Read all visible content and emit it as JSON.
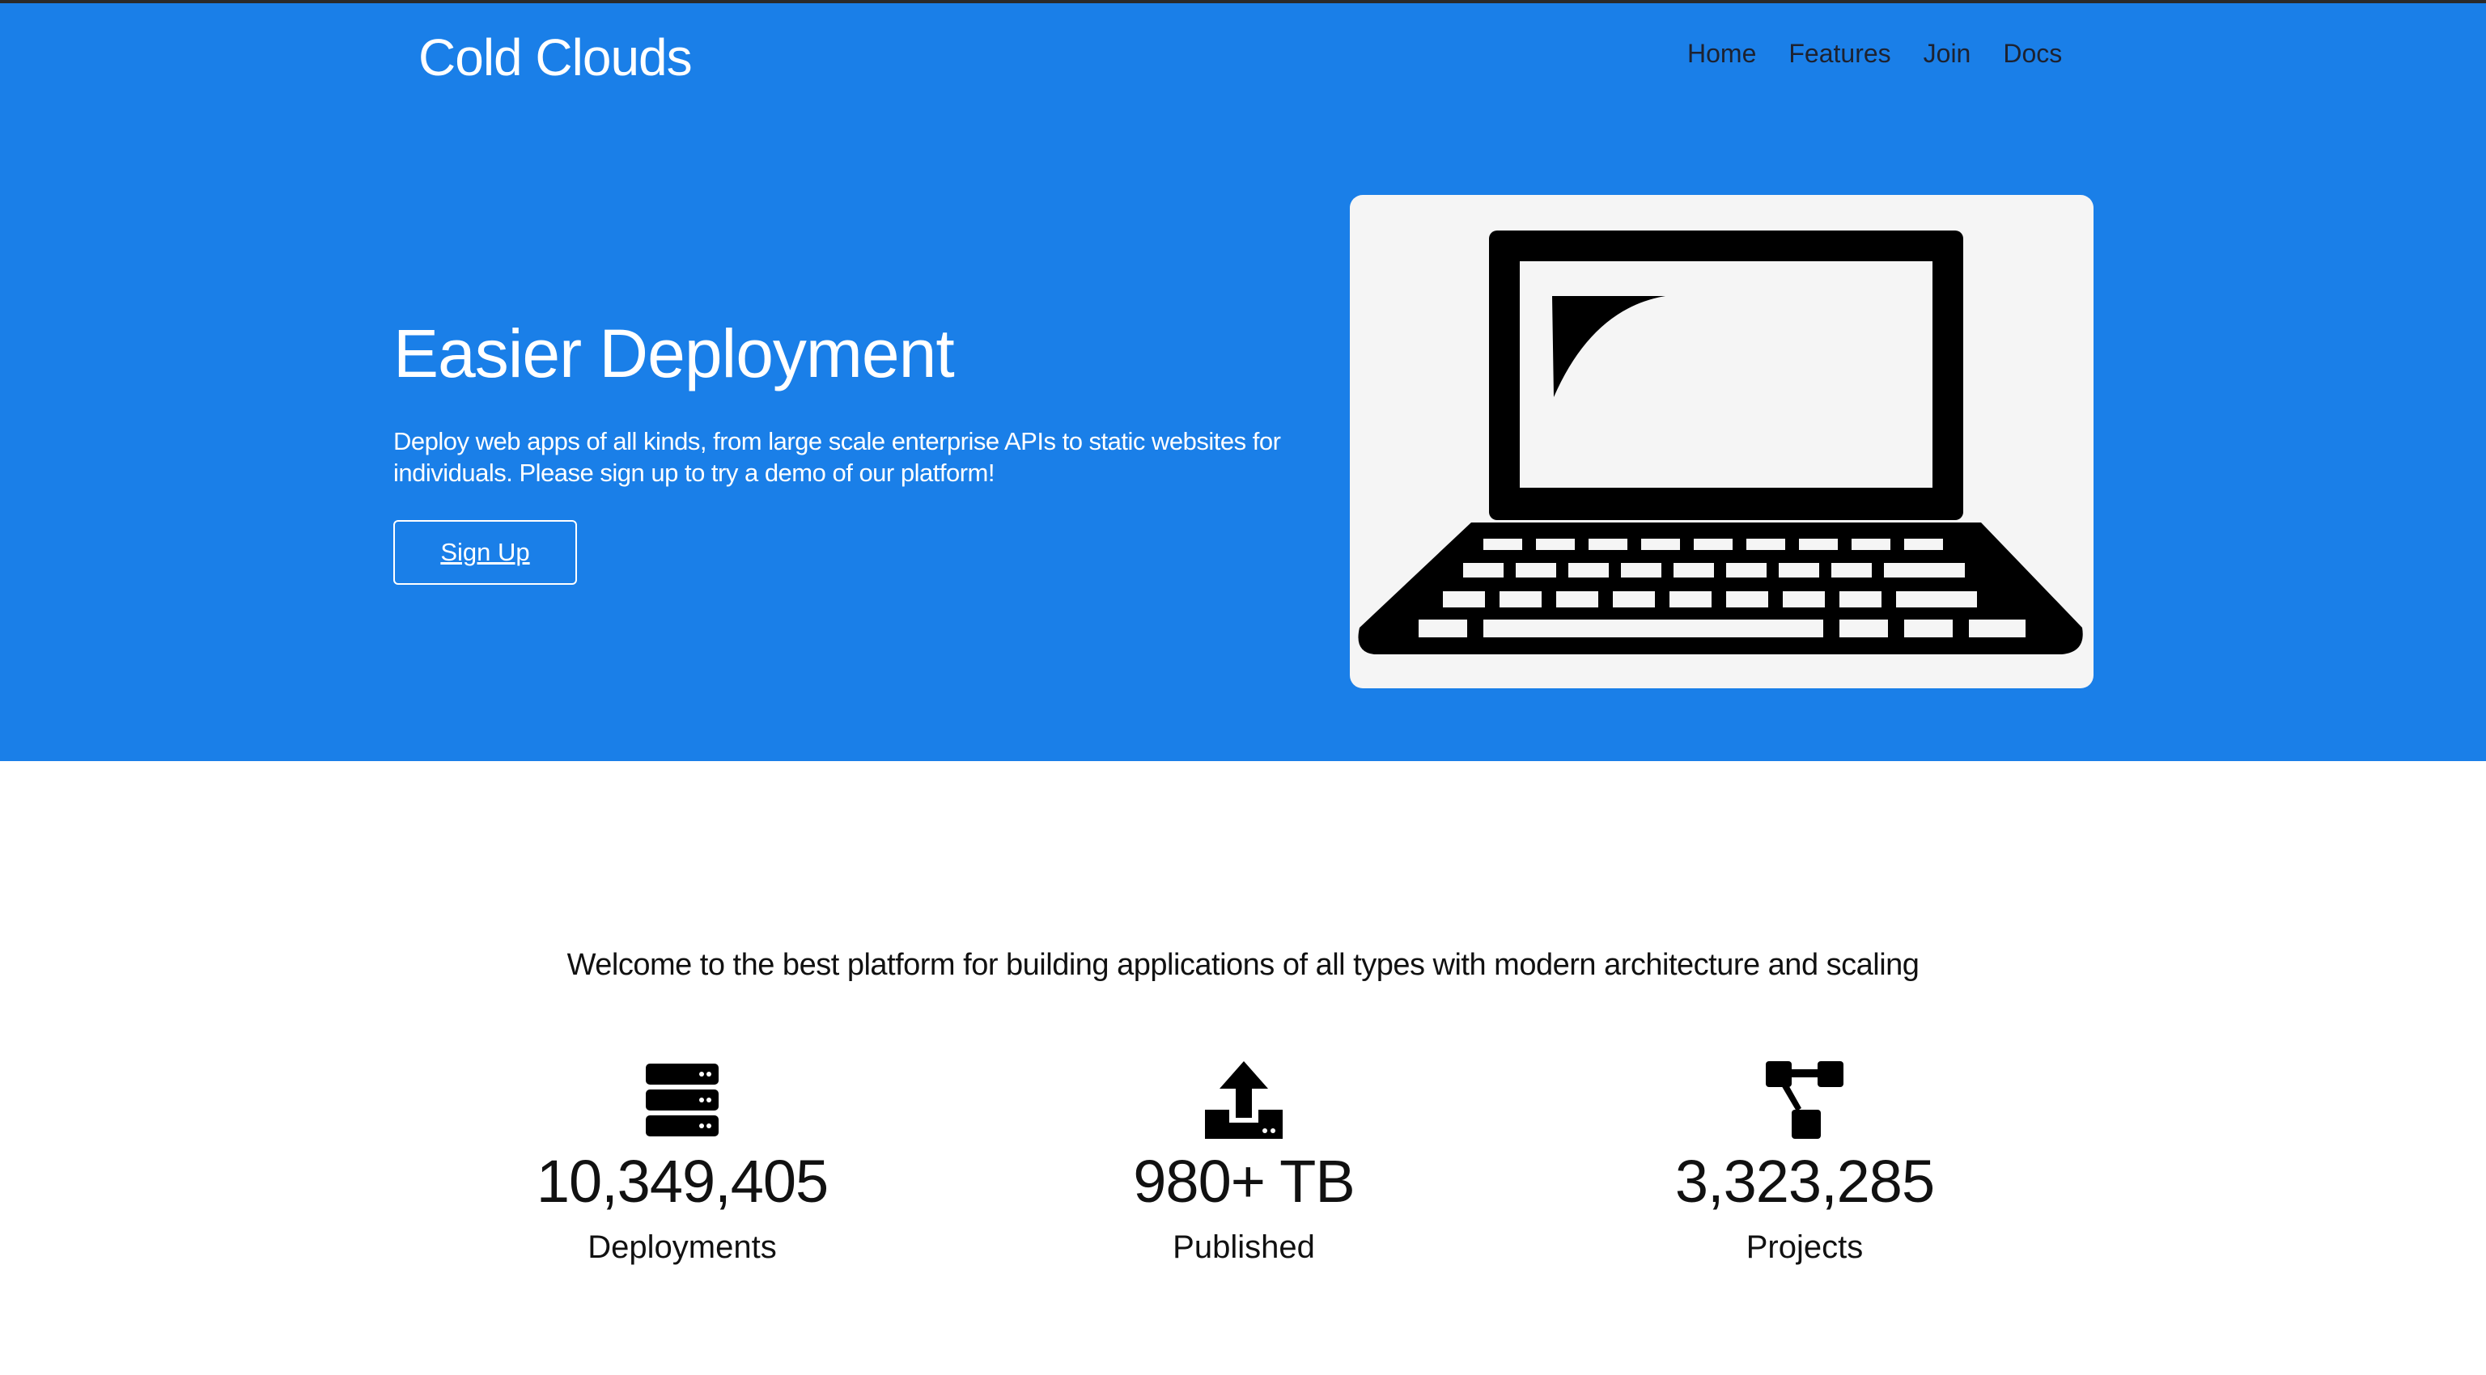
{
  "header": {
    "logo": "Cold Clouds",
    "nav": [
      "Home",
      "Features",
      "Join",
      "Docs"
    ]
  },
  "hero": {
    "title": "Easier Deployment",
    "description": "Deploy web apps of all kinds, from large scale enterprise APIs to static websites for individuals. Please sign up to try a demo of our platform!",
    "cta": "Sign Up",
    "image_icon": "laptop-icon",
    "background": "#1a7fe8"
  },
  "features": {
    "welcome": "Welcome to the best platform for building applications of all types with modern architecture and scaling",
    "stats": [
      {
        "icon": "server-icon",
        "value": "10,349,405",
        "label": "Deployments"
      },
      {
        "icon": "upload-icon",
        "value": "980+ TB",
        "label": "Published"
      },
      {
        "icon": "sitemap-icon",
        "value": "3,323,285",
        "label": "Projects"
      }
    ]
  }
}
